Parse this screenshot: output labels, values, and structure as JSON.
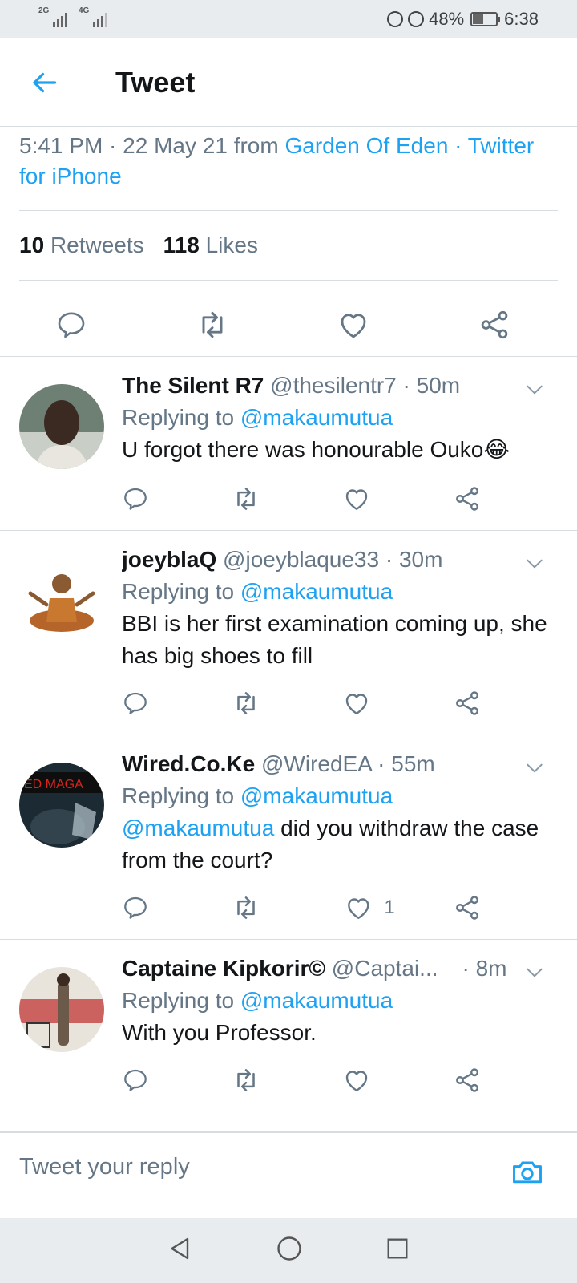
{
  "status_bar": {
    "net1": "2G",
    "net2": "4G",
    "battery": "48%",
    "battery_level": 0.48,
    "time": "6:38"
  },
  "header": {
    "title": "Tweet"
  },
  "tweet": {
    "time": "5:41 PM",
    "date": "22 May 21",
    "from_word": "from",
    "location": "Garden Of Eden",
    "source": "Twitter for iPhone",
    "retweets_count": "10",
    "retweets_label": "Retweets",
    "likes_count": "118",
    "likes_label": "Likes"
  },
  "replies": [
    {
      "name": "The Silent R7",
      "handle": "@thesilentr7",
      "age": "· 50m",
      "replying_label": "Replying to",
      "replying_to": "@makaumutua",
      "text": "U forgot there was honourable Ouko😂",
      "like_count": ""
    },
    {
      "name": "joeyblaQ",
      "handle": "@joeyblaque33",
      "age": "· 30m",
      "replying_label": "Replying to",
      "replying_to": "@makaumutua",
      "text": "BBI is her first examination coming up, she has big shoes to fill",
      "like_count": ""
    },
    {
      "name": "Wired.Co.Ke",
      "handle": "@WiredEA",
      "age": "· 55m",
      "replying_label": "Replying to",
      "replying_to": "@makaumutua",
      "mention": "@makaumutua",
      "text": " did you withdraw the case from the court?",
      "like_count": "1"
    },
    {
      "name": "Captaine Kipkorir©",
      "handle": "@Captai...",
      "age": "· 8m",
      "replying_label": "Replying to",
      "replying_to": "@makaumutua",
      "text": "With you Professor.",
      "like_count": ""
    }
  ],
  "reply_box": {
    "placeholder": "Tweet your reply"
  },
  "colors": {
    "accent": "#1da1f2",
    "text": "#14171a",
    "muted": "#657786",
    "icon": "#657786"
  },
  "icons": [
    "back-arrow-icon",
    "reply-icon",
    "retweet-icon",
    "like-icon",
    "share-icon",
    "chevron-down-icon",
    "camera-icon",
    "nav-back-icon",
    "nav-home-icon",
    "nav-recents-icon"
  ]
}
